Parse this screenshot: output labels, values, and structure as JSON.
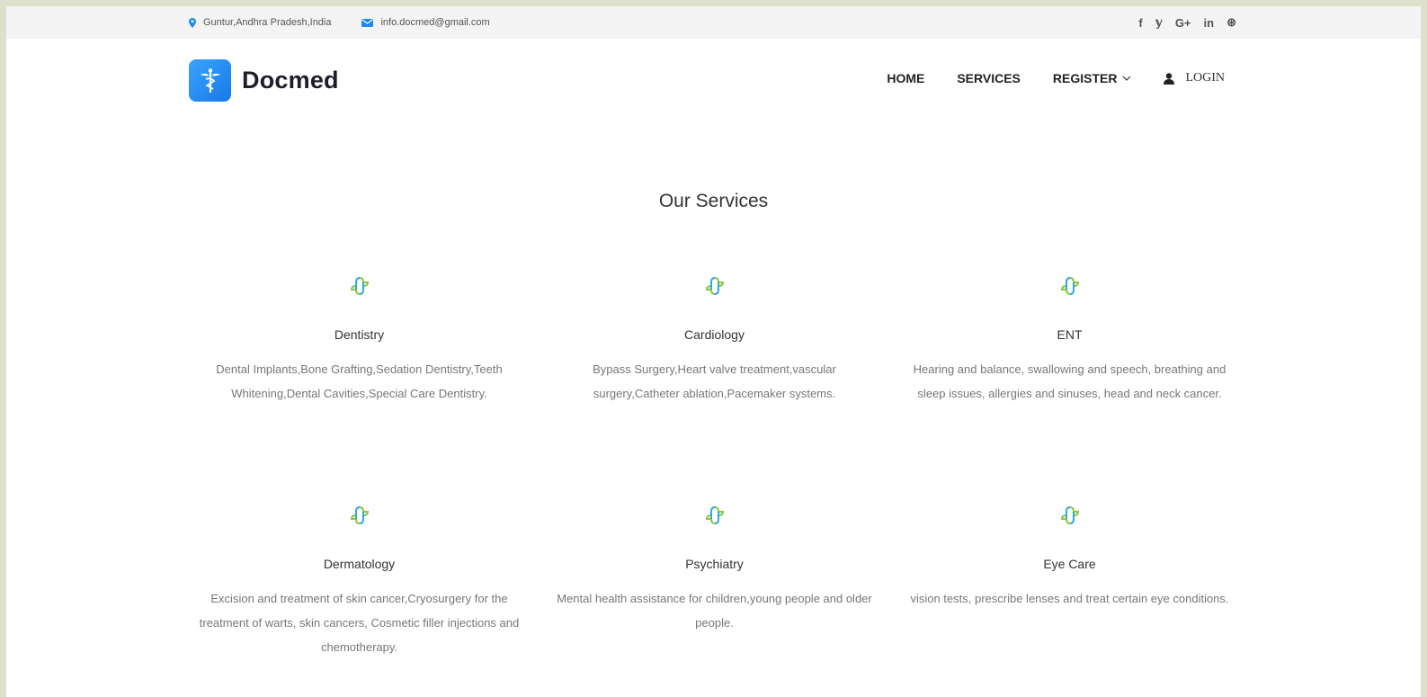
{
  "topbar": {
    "location": "Guntur,Andhra Pradesh,India",
    "email": "info.docmed@gmail.com",
    "social": [
      "f",
      "𝕪",
      "G+",
      "in",
      "⊛"
    ]
  },
  "brand": {
    "name": "Docmed"
  },
  "nav": {
    "home": "HOME",
    "services": "SERVICES",
    "register": "REGISTER",
    "login": "LOGIN"
  },
  "services": {
    "title": "Our Services",
    "items": [
      {
        "name": "Dentistry",
        "desc": "Dental Implants,Bone Grafting,Sedation Dentistry,Teeth Whitening,Dental Cavities,Special Care Dentistry."
      },
      {
        "name": "Cardiology",
        "desc": "Bypass Surgery,Heart valve treatment,vascular surgery,Catheter ablation,Pacemaker systems."
      },
      {
        "name": "ENT",
        "desc": "Hearing and balance, swallowing and speech, breathing and sleep issues, allergies and sinuses, head and neck cancer."
      },
      {
        "name": "Dermatology",
        "desc": "Excision and treatment of skin cancer,Cryosurgery for the treatment of warts, skin cancers, Cosmetic filler injections and chemotherapy."
      },
      {
        "name": "Psychiatry",
        "desc": "Mental health assistance for children,young people and older people."
      },
      {
        "name": "Eye Care",
        "desc": "vision tests, prescribe lenses and treat certain eye conditions."
      }
    ]
  },
  "colors": {
    "accent": "#1e88f0",
    "cross_green": "#8cc63f",
    "cross_blue": "#29abe2"
  }
}
